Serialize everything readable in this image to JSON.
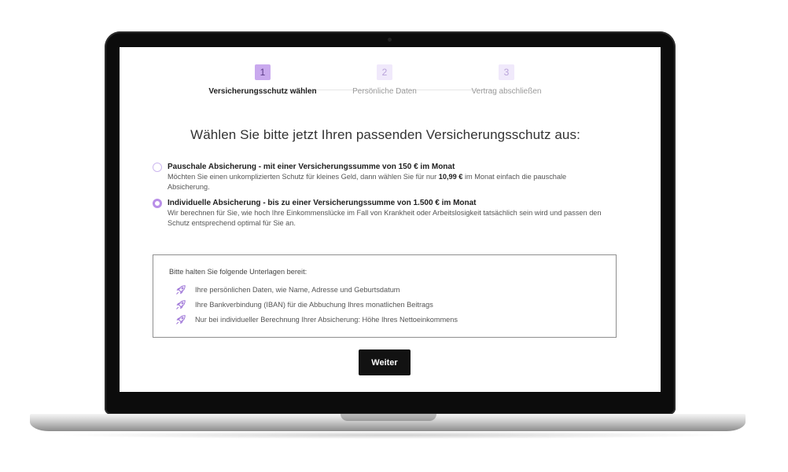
{
  "stepper": {
    "steps": [
      {
        "number": "1",
        "label": "Versicherungsschutz wählen",
        "state": "active"
      },
      {
        "number": "2",
        "label": "Persönliche Daten",
        "state": "inactive"
      },
      {
        "number": "3",
        "label": "Vertrag abschließen",
        "state": "inactive"
      }
    ]
  },
  "main": {
    "heading": "Wählen Sie bitte jetzt Ihren passenden Versicherungsschutz aus:",
    "options": [
      {
        "title": "Pauschale Absicherung - mit einer Versicherungssumme von 150 € im Monat",
        "desc_before": "Möchten Sie einen unkomplizierten Schutz für kleines Geld, dann wählen Sie für nur ",
        "desc_bold": "10,99 €",
        "desc_after": " im Monat einfach die pauschale Absicherung.",
        "selected": false
      },
      {
        "title": "Individuelle Absicherung - bis zu einer Versicherungssumme von 1.500 € im Monat",
        "desc": "Wir berechnen für Sie, wie hoch Ihre Einkommenslücke im Fall von Krankheit oder Arbeitslosigkeit tatsächlich sein wird und passen den Schutz entsprechend optimal für Sie an.",
        "selected": true
      }
    ],
    "documents": {
      "intro": "Bitte halten Sie folgende Unterlagen bereit:",
      "items": [
        "Ihre persönlichen Daten, wie Name, Adresse und Geburtsdatum",
        "Ihre Bankverbindung (IBAN) für die Abbuchung Ihres monatlichen Beitrags",
        "Nur bei individueller Berechnung Ihrer Absicherung: Höhe Ihres Nettoeinkommens"
      ],
      "icon": "rocket-icon"
    },
    "button_label": "Weiter"
  },
  "colors": {
    "accent": "#c9a9ee",
    "accent_light": "#f0e9fb",
    "radio_checked": "#b98fe8",
    "button_bg": "#121212"
  }
}
